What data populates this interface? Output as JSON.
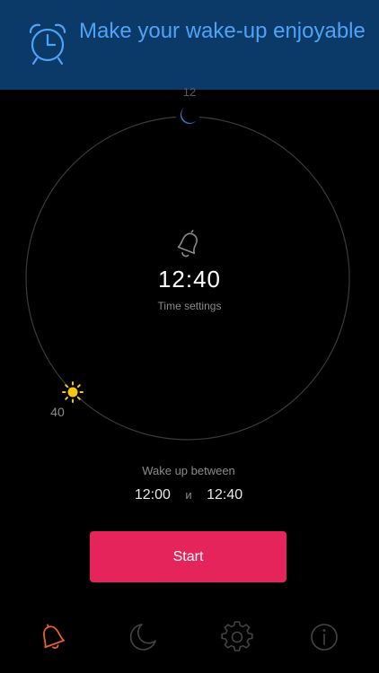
{
  "banner": {
    "headline": "Make your wake-up enjoyable",
    "icon": "alarm-clock-icon",
    "background": "#0b3a68",
    "accent": "#4ea3f5"
  },
  "dial": {
    "tick_top": "12",
    "tick_bottom_left": "40",
    "start_icon": "moon-icon",
    "end_icon": "sun-icon",
    "center_icon": "bell-icon",
    "time": "12:40",
    "subtitle": "Time settings",
    "moon_color": "#2f7fd6",
    "sun_color": "#f5c518"
  },
  "wake": {
    "label": "Wake up between",
    "from": "12:00",
    "conjunction": "и",
    "to": "12:40"
  },
  "start_button": {
    "label": "Start",
    "color": "#e4245a"
  },
  "tabbar": {
    "items": [
      {
        "icon": "bell-icon",
        "active": true,
        "color": "#e8602c"
      },
      {
        "icon": "moon-icon",
        "active": false
      },
      {
        "icon": "gear-icon",
        "active": false
      },
      {
        "icon": "info-icon",
        "active": false
      }
    ]
  }
}
